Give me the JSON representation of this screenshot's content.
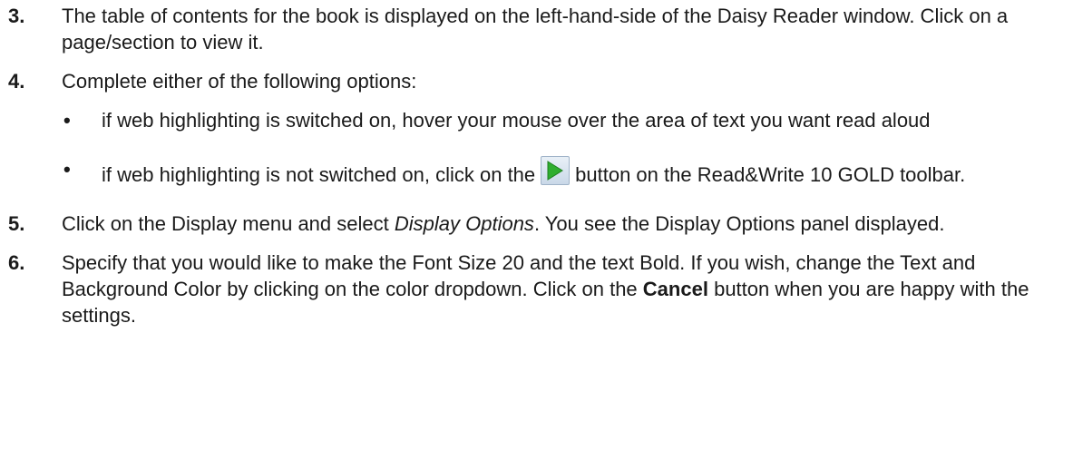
{
  "steps": [
    {
      "number": "3.",
      "text": "The table of contents for the book is displayed on the left-hand-side of the Daisy Reader window. Click on a page/section to view it."
    },
    {
      "number": "4.",
      "text": "Complete either of the following options:",
      "bullets": [
        {
          "marker": "•",
          "text": "if web highlighting is switched on, hover your mouse over the area of text you want read aloud"
        },
        {
          "marker": "•",
          "text_before": "if web highlighting is not switched on, click on the",
          "icon": "play-icon",
          "text_after": "button on the Read&Write 10 GOLD toolbar."
        }
      ]
    },
    {
      "number": "5.",
      "text_before": "Click on the Display menu and select",
      "emphasis": "Display Options",
      "text_after": ". You see the Display Options panel displayed."
    },
    {
      "number": "6.",
      "text_before": "Specify that you would like to make the Font Size 20 and the text Bold. If you wish, change the Text and Background Color by clicking on the color dropdown. Click on the",
      "strong": "Cancel",
      "text_after": "button when you are happy with the settings."
    }
  ],
  "colors": {
    "text": "#1a1a1a",
    "play_green": "#2fae2f"
  }
}
